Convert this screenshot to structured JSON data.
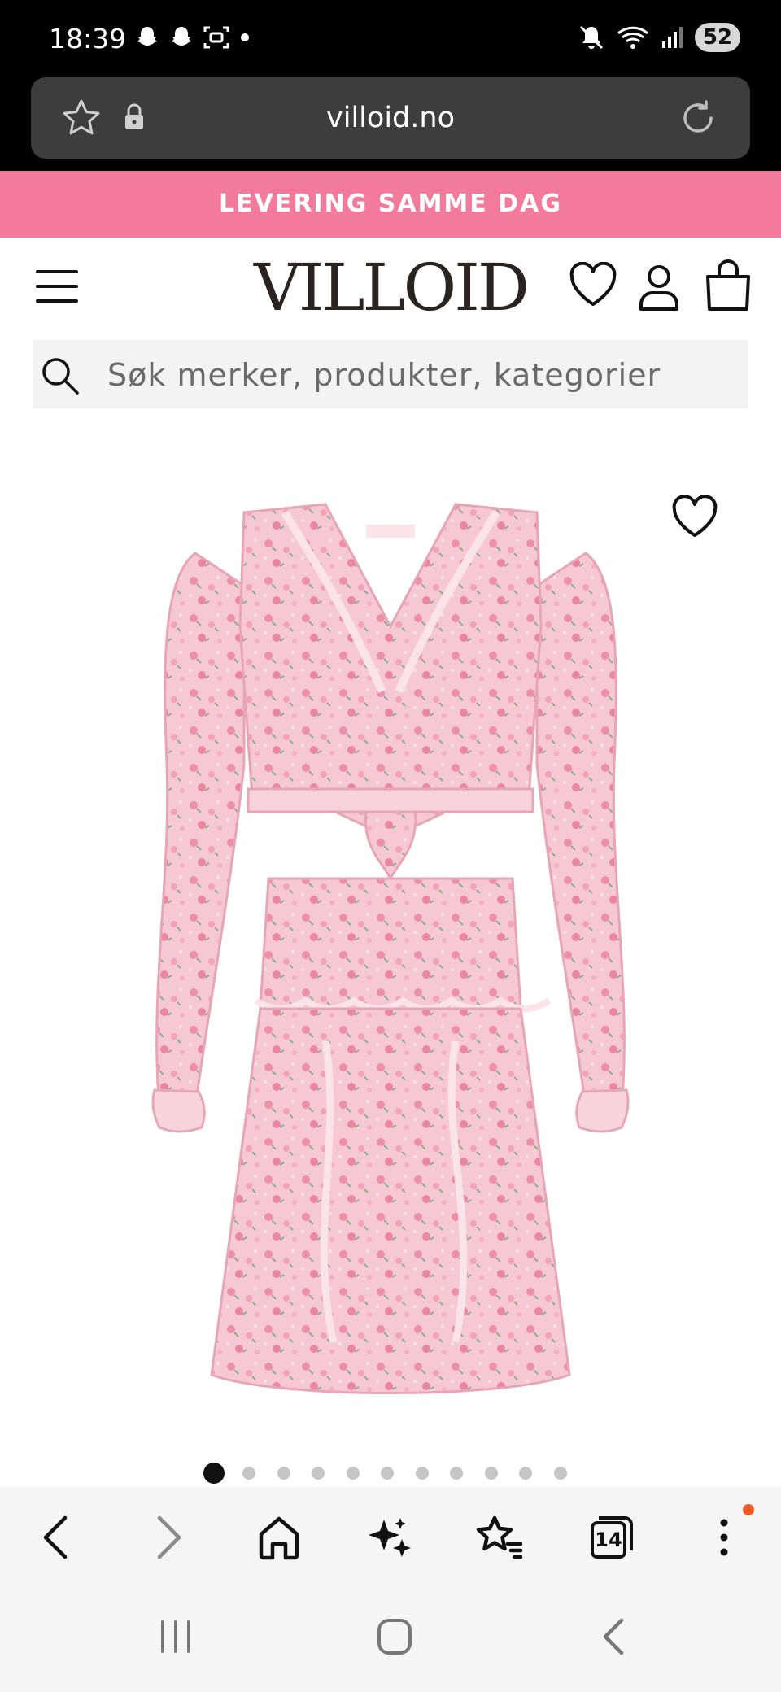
{
  "status_bar": {
    "time": "18:39",
    "battery": "52",
    "left_icons": [
      "snapchat-icon",
      "snapchat-icon",
      "screenshot-icon",
      "dot-icon"
    ],
    "right_icons": [
      "mute-icon",
      "wifi-icon",
      "signal-icon"
    ]
  },
  "browser": {
    "url": "villoid.no",
    "tab_count": "14"
  },
  "promo": {
    "text": "LEVERING SAMME DAG",
    "color": "#f27b9c"
  },
  "header": {
    "logo": "VILLOID"
  },
  "search": {
    "placeholder": "Søk merker, produkter, kategorier"
  },
  "product": {
    "image_label": "Pink floral ruffled cut-out mini dress",
    "carousel_total": 11,
    "carousel_active": 1
  },
  "toolbar": {
    "items": [
      "back-icon",
      "forward-icon",
      "home-icon",
      "sparkle-icon",
      "bookmarks-icon",
      "tabs-icon",
      "more-icon"
    ]
  }
}
